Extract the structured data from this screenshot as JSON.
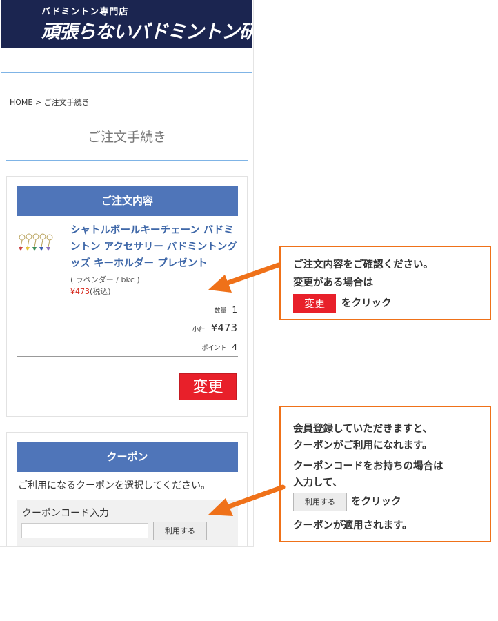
{
  "header": {
    "store_type": "バドミントン専門店",
    "store_name": "頑張らないバドミントン研究会"
  },
  "breadcrumb": "HOME > ご注文手続き",
  "page_title": "ご注文手続き",
  "order": {
    "heading": "ご注文内容",
    "product_name": "シャトルボールキーチェーン バドミントン アクセサリー バドミントングッズ キーホルダー プレゼント",
    "variant": "( ラベンダー / bkc )",
    "price": "¥473",
    "tax_note": "(税込)",
    "qty_label": "数量",
    "qty_value": "1",
    "subtotal_label": "小計",
    "subtotal_value": "¥473",
    "points_label": "ポイント",
    "points_value": "4",
    "change_button": "変更"
  },
  "coupon": {
    "heading": "クーポン",
    "description": "ご利用になるクーポンを選択してください。",
    "code_label": "クーポンコード入力",
    "code_value": "",
    "apply_button": "利用する"
  },
  "callout1": {
    "line1": "ご注文内容をご確認ください。",
    "line2": "変更がある場合は",
    "button": "変更",
    "line3": "をクリック"
  },
  "callout2": {
    "line1": "会員登録していただきますと、",
    "line2": "クーポンがご利用になれます。",
    "line3": "クーポンコードをお持ちの場合は",
    "line4": "入力して、",
    "button": "利用する",
    "line5": "をクリック",
    "line6": "クーポンが適用されます。"
  },
  "colors": {
    "header_bg": "#1b2550",
    "section_header": "#4f75b9",
    "accent_red": "#e8202a",
    "callout_border": "#ef7119",
    "link_blue": "#3e67a8"
  }
}
